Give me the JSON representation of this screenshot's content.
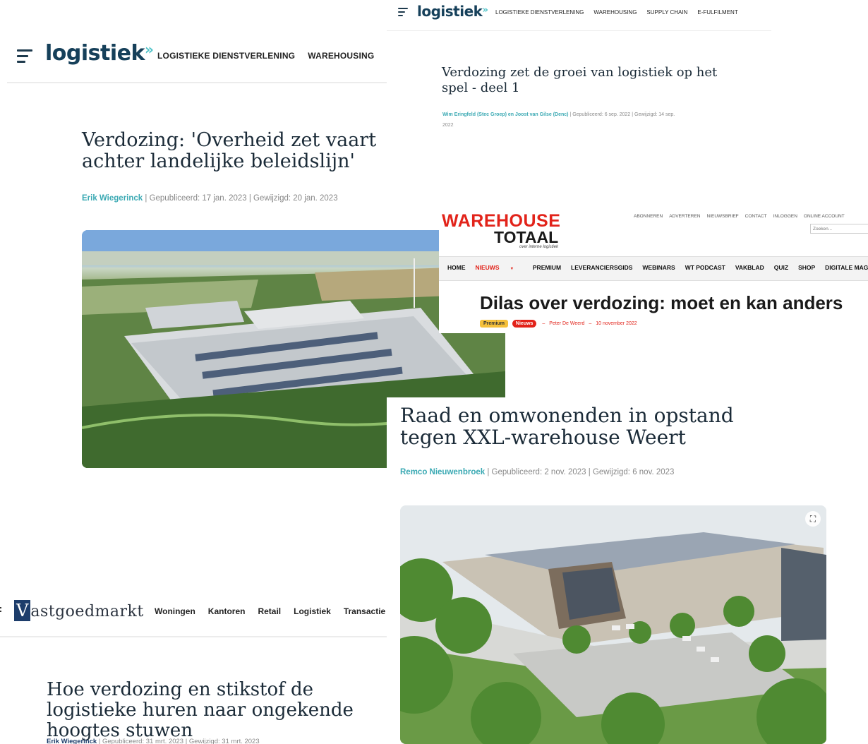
{
  "logistiek_main": {
    "logo": "logistiek",
    "logo_suffix": "»",
    "nav": [
      "LOGISTIEKE DIENSTVERLENING",
      "WAREHOUSING"
    ],
    "title": "Verdozing: 'Overheid zet vaart achter landelijke beleidslijn'",
    "author": "Erik Wiegerinck",
    "meta": " | Gepubliceerd: 17 jan. 2023 | Gewijzigd: 20 jan. 2023"
  },
  "logistiek_top": {
    "logo": "logistiek",
    "logo_suffix": "»",
    "nav": [
      "LOGISTIEKE DIENSTVERLENING",
      "WAREHOUSING",
      "SUPPLY CHAIN",
      "E-FULFILMENT"
    ],
    "title": "Verdozing zet de groei van logistiek op het spel - deel 1",
    "author": "Wim Eringfeld (Stec Groep) en Joost van Gilse (Denc)",
    "meta_line1": " | Gepubliceerd: 6 sep. 2022 | Gewijzigd: 14 sep.",
    "meta_line2": "2022"
  },
  "warehouse_totaal": {
    "logo_line1": "WAREHOUSE",
    "logo_line2": "TOTAAL",
    "tagline": "over interne logistiek",
    "top_links": [
      "ABONNEREN",
      "ADVERTEREN",
      "NIEUWSBRIEF",
      "CONTACT",
      "INLOGGEN",
      "ONLINE ACCOUNT"
    ],
    "search_placeholder": "Zoeken...",
    "nav": [
      "HOME",
      "NIEUWS",
      "PREMIUM",
      "LEVERANCIERSGIDS",
      "WEBINARS",
      "WT PODCAST",
      "VAKBLAD",
      "QUIZ",
      "SHOP",
      "DIGITALE MAGAZINE"
    ],
    "title": "Dilas over verdozing: moet en kan anders",
    "badge_premium": "Premium",
    "badge_nieuws": "Nieuws",
    "author": "Peter De Weerd",
    "date": "10 november 2022",
    "separator": "–"
  },
  "logistiek_weert": {
    "title": "Raad en omwonenden in opstand tegen XXL-warehouse Weert",
    "author": "Remco Nieuwenbroek",
    "meta": " | Gepubliceerd: 2 nov. 2023 | Gewijzigd: 6 nov. 2023"
  },
  "vastgoedmarkt": {
    "logo_initial": "V",
    "logo_rest": "astgoedmarkt",
    "nav": [
      "Woningen",
      "Kantoren",
      "Retail",
      "Logistiek",
      "Transactie"
    ],
    "title": "Hoe verdozing en stikstof de logistieke huren naar ongekende hoogtes stuwen",
    "author": "Erik Wiegerinck",
    "meta": " | Gepubliceerd: 31 mrt. 2023 | Gewijzigd: 31 mrt. 2023"
  },
  "colors": {
    "brand_navy": "#16405a",
    "brand_teal": "#4fc3c8",
    "wt_red": "#e2231a"
  },
  "icons": [
    "menu-icon",
    "expand-icon"
  ]
}
